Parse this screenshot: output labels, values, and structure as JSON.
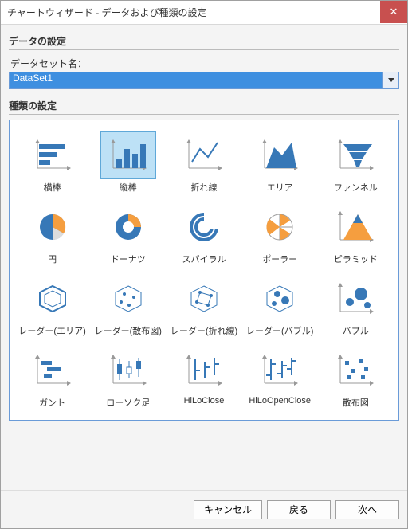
{
  "window": {
    "title": "チャートウィザード - データおよび種類の設定"
  },
  "sections": {
    "data": "データの設定",
    "kind": "種類の設定"
  },
  "dataset": {
    "label": "データセット名：",
    "value": "DataSet1"
  },
  "charts": [
    {
      "key": "bar-h",
      "label": "横棒"
    },
    {
      "key": "bar-v",
      "label": "縦棒"
    },
    {
      "key": "line",
      "label": "折れ線"
    },
    {
      "key": "area",
      "label": "エリア"
    },
    {
      "key": "funnel",
      "label": "ファンネル"
    },
    {
      "key": "pie",
      "label": "円"
    },
    {
      "key": "donut",
      "label": "ドーナツ"
    },
    {
      "key": "spiral",
      "label": "スパイラル"
    },
    {
      "key": "polar",
      "label": "ポーラー"
    },
    {
      "key": "pyramid",
      "label": "ピラミッド"
    },
    {
      "key": "radar-area",
      "label": "レーダー(エリア)"
    },
    {
      "key": "radar-scatter",
      "label": "レーダー(散布図)"
    },
    {
      "key": "radar-line",
      "label": "レーダー(折れ線)"
    },
    {
      "key": "radar-bubble",
      "label": "レーダー(バブル)"
    },
    {
      "key": "bubble",
      "label": "バブル"
    },
    {
      "key": "gantt",
      "label": "ガント"
    },
    {
      "key": "candle",
      "label": "ローソク足"
    },
    {
      "key": "hiloclose",
      "label": "HiLoClose"
    },
    {
      "key": "hiloopenclose",
      "label": "HiLoOpenClose"
    },
    {
      "key": "scatter",
      "label": "散布図"
    }
  ],
  "selected_chart": "bar-v",
  "footer": {
    "cancel": "キャンセル",
    "back": "戻る",
    "next": "次へ"
  }
}
